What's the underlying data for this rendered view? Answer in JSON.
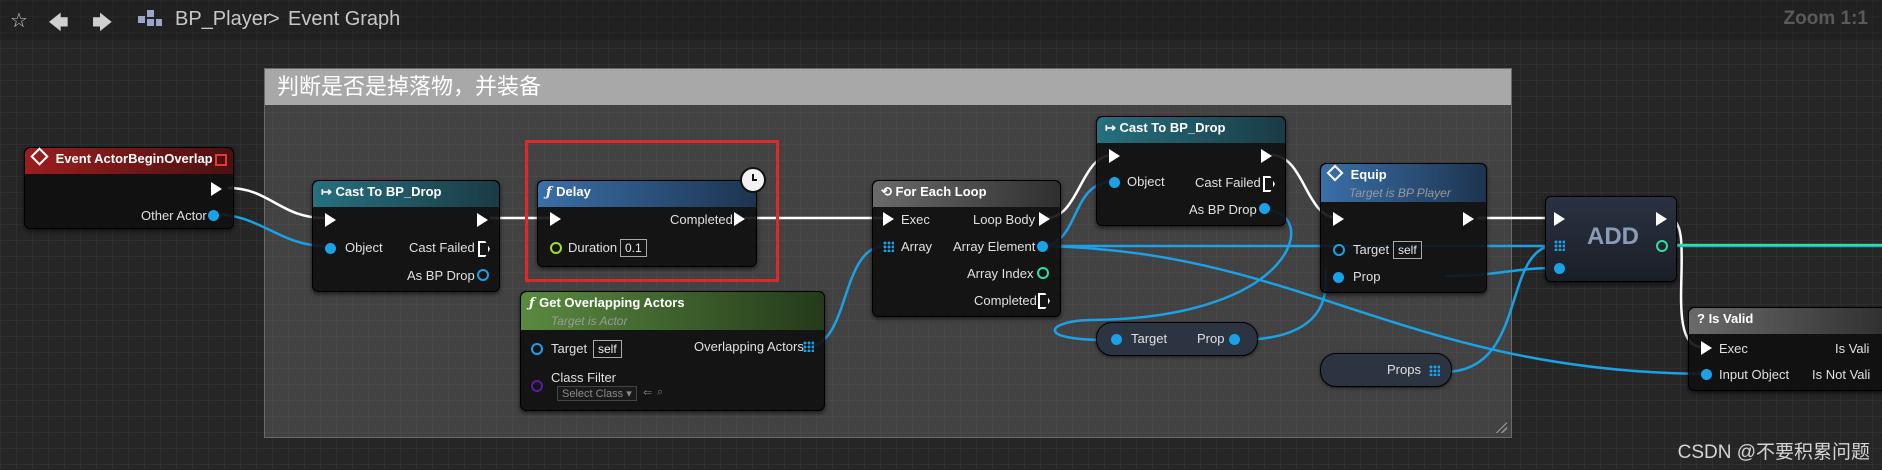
{
  "toolbar": {
    "star_icon": "star-icon",
    "back_icon": "back-arrow-icon",
    "forward_icon": "forward-arrow-icon",
    "blueprint_icon": "blueprint-grid-icon",
    "breadcrumb_blueprint": "BP_Player",
    "breadcrumb_sep": ">",
    "breadcrumb_graph": "Event Graph",
    "zoom": "Zoom 1:1"
  },
  "comment": {
    "title": "判断是否是掉落物，并装备"
  },
  "nodes": {
    "event_overlap": {
      "title": "Event ActorBeginOverlap",
      "pin_other_actor": "Other Actor"
    },
    "cast1": {
      "title": "Cast To BP_Drop",
      "pin_object": "Object",
      "pin_cast_failed": "Cast Failed",
      "pin_as": "As BP Drop"
    },
    "delay": {
      "title": "Delay",
      "pin_completed": "Completed",
      "pin_duration": "Duration",
      "duration_value": "0.1"
    },
    "get_overlapping": {
      "title": "Get Overlapping Actors",
      "subtitle": "Target is Actor",
      "pin_target": "Target",
      "target_value": "self",
      "pin_overlapping": "Overlapping Actors",
      "pin_class_filter": "Class Filter",
      "class_value": "Select Class"
    },
    "foreach": {
      "title": "For Each Loop",
      "pin_exec": "Exec",
      "pin_loop_body": "Loop Body",
      "pin_array": "Array",
      "pin_array_element": "Array Element",
      "pin_array_index": "Array Index",
      "pin_completed": "Completed"
    },
    "cast2": {
      "title": "Cast To BP_Drop",
      "pin_object": "Object",
      "pin_cast_failed": "Cast Failed",
      "pin_as": "As BP Drop"
    },
    "equip": {
      "title": "Equip",
      "subtitle": "Target is BP Player",
      "pin_target": "Target",
      "target_value": "self",
      "pin_prop": "Prop"
    },
    "target_prop": {
      "pin_target": "Target",
      "pin_prop": "Prop"
    },
    "props_var": {
      "label": "Props"
    },
    "add": {
      "label": "ADD"
    },
    "is_valid": {
      "title": "Is Valid",
      "pin_exec": "Exec",
      "pin_is_valid": "Is Vali",
      "pin_input_object": "Input Object",
      "pin_is_not_valid": "Is Not Vali"
    }
  },
  "watermark": "CSDN @不要积累问题",
  "colors": {
    "event_header": "#8b1a1a",
    "cast_header": "#1f5c6b",
    "function_header": "#2d5a8a",
    "pure_function_header": "#4a6b35",
    "macro_header": "#5a5a5a",
    "object_pin": "#1aa1e6",
    "int_pin": "#2de0a0",
    "class_pin": "#5a1aa1",
    "float_pin": "#9de02d",
    "highlight": "#e0282c"
  }
}
